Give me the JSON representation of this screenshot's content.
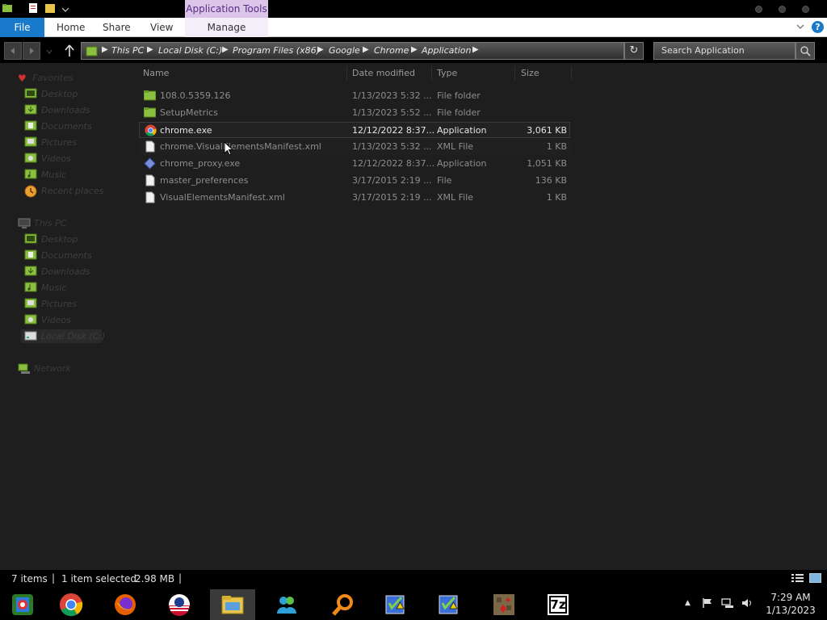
{
  "ribbon": {
    "contextual_group": "Application Tools",
    "tabs": {
      "file": "File",
      "home": "Home",
      "share": "Share",
      "view": "View",
      "manage": "Manage"
    },
    "help": "?"
  },
  "address": {
    "crumbs": [
      "This PC",
      "Local Disk (C:)",
      "Program Files (x86)",
      "Google",
      "Chrome",
      "Application"
    ],
    "search_placeholder": "Search Application"
  },
  "nav": {
    "favorites_header": "Favorites",
    "favorites": [
      "Desktop",
      "Downloads",
      "Documents",
      "Pictures",
      "Videos",
      "Music",
      "Recent places"
    ],
    "thispc_header": "This PC",
    "thispc": [
      "Desktop",
      "Documents",
      "Downloads",
      "Music",
      "Pictures",
      "Videos",
      "Local Disk (C:)"
    ],
    "network": "Network"
  },
  "columns": {
    "name": "Name",
    "date": "Date modified",
    "type": "Type",
    "size": "Size"
  },
  "files": [
    {
      "name": "108.0.5359.126",
      "date": "1/13/2023 5:32 ...",
      "type": "File folder",
      "size": "",
      "icon": "folder-icon"
    },
    {
      "name": "SetupMetrics",
      "date": "1/13/2023 5:52 ...",
      "type": "File folder",
      "size": "",
      "icon": "folder-icon"
    },
    {
      "name": "chrome.exe",
      "date": "12/12/2022 8:37...",
      "type": "Application",
      "size": "3,061 KB",
      "icon": "chrome-icon"
    },
    {
      "name": "chrome.VisualElementsManifest.xml",
      "date": "1/13/2023 5:32 ...",
      "type": "XML File",
      "size": "1 KB",
      "icon": "document-icon"
    },
    {
      "name": "chrome_proxy.exe",
      "date": "12/12/2022 8:37...",
      "type": "Application",
      "size": "1,051 KB",
      "icon": "app-exe-icon"
    },
    {
      "name": "master_preferences",
      "date": "3/17/2015 2:19 ...",
      "type": "File",
      "size": "136 KB",
      "icon": "document-icon"
    },
    {
      "name": "VisualElementsManifest.xml",
      "date": "3/17/2015 2:19 ...",
      "type": "XML File",
      "size": "1 KB",
      "icon": "document-icon"
    }
  ],
  "status": {
    "items": "7 items",
    "selected": "1 item selected",
    "size": "2.98 MB"
  },
  "taskbar": {
    "apps": [
      "start-orb-icon",
      "chrome-icon",
      "firefox-icon",
      "obama-logo-icon",
      "file-explorer-icon",
      "messenger-icon",
      "search-magnifier-icon",
      "checklist-icon",
      "checklist-icon",
      "game-icon",
      "7zip-icon"
    ],
    "seven_zip_label": "7z",
    "time": "7:29 AM",
    "date": "1/13/2023"
  },
  "colors": {
    "file_tab": "#1979ca",
    "app_tools": "#dbc6ea",
    "background": "#1e1e1e",
    "folder": "#8bbf3f"
  }
}
